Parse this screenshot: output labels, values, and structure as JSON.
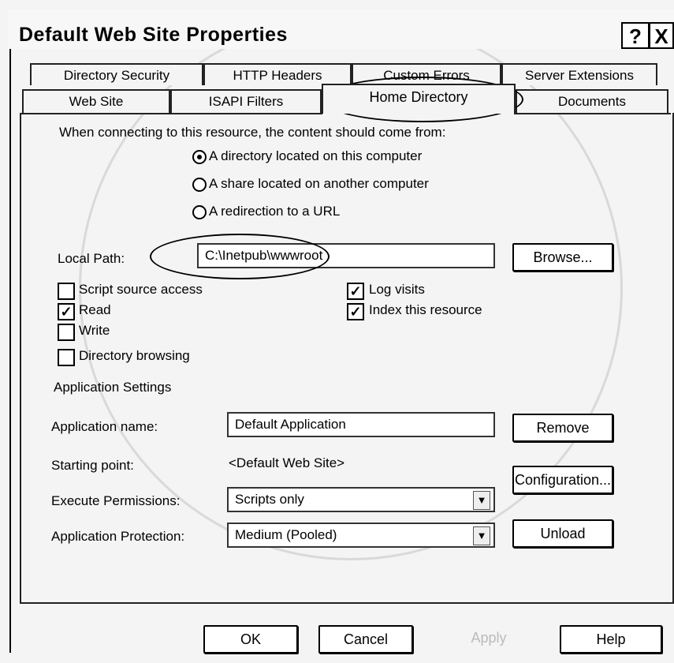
{
  "window": {
    "title": "Default Web Site Properties",
    "help_glyph": "?",
    "close_glyph": "X"
  },
  "tabs_row1": [
    {
      "label": "Directory Security"
    },
    {
      "label": "HTTP Headers"
    },
    {
      "label": "Custom Errors"
    },
    {
      "label": "Server Extensions"
    }
  ],
  "tabs_row2": [
    {
      "label": "Web Site"
    },
    {
      "label": "ISAPI Filters"
    },
    {
      "label": "Home Directory",
      "active": true
    },
    {
      "label": "Documents"
    }
  ],
  "content_source": {
    "prompt": "When connecting to this resource, the content should come from:",
    "options": [
      {
        "label": "A directory located on this computer",
        "selected": true
      },
      {
        "label": "A share located on another computer",
        "selected": false
      },
      {
        "label": "A redirection to a URL",
        "selected": false
      }
    ]
  },
  "local_path": {
    "label": "Local Path:",
    "value": "C:\\Inetpub\\wwwroot",
    "browse_label": "Browse..."
  },
  "checkboxes_left": [
    {
      "label": "Script source access",
      "checked": false
    },
    {
      "label": "Read",
      "checked": true
    },
    {
      "label": "Write",
      "checked": false
    },
    {
      "label": "Directory browsing",
      "checked": false
    }
  ],
  "checkboxes_right": [
    {
      "label": "Log visits",
      "checked": true
    },
    {
      "label": "Index this resource",
      "checked": true
    }
  ],
  "app_settings": {
    "heading": "Application Settings",
    "name_label": "Application name:",
    "name_value": "Default Application",
    "remove_label": "Remove",
    "starting_point_label": "Starting point:",
    "starting_point_value": "<Default Web Site>",
    "configuration_label": "Configuration...",
    "exec_perm_label": "Execute Permissions:",
    "exec_perm_value": "Scripts only",
    "protection_label": "Application Protection:",
    "protection_value": "Medium (Pooled)",
    "unload_label": "Unload"
  },
  "footer": {
    "ok_label": "OK",
    "cancel_label": "Cancel",
    "apply_label": "Apply",
    "help_label": "Help"
  },
  "icons": {
    "check": "check-icon",
    "dropdown": "chevron-down-icon"
  }
}
